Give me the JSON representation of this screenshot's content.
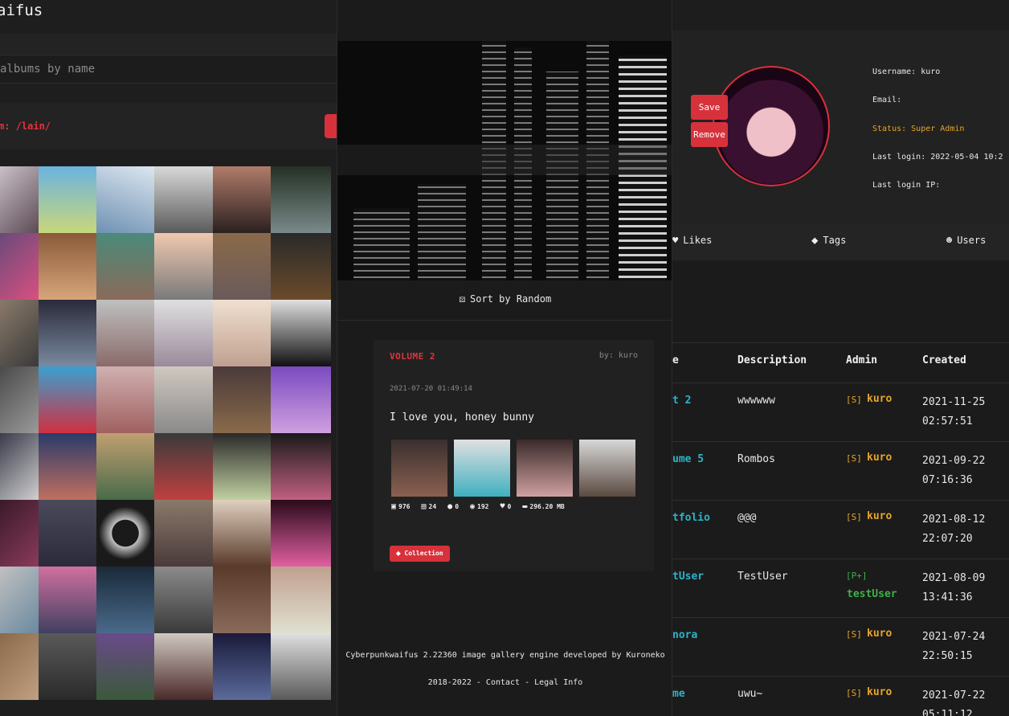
{
  "left": {
    "title": "aifus",
    "search_placeholder": "albums by name",
    "album_path": "m: /lain/"
  },
  "middle": {
    "sort_label": "Sort by Random",
    "card": {
      "volume": "VOLUME 2",
      "by": "by: kuro",
      "date": "2021-07-20 01:49:14",
      "description": "I love you, honey bunny",
      "stats": {
        "images": "976",
        "videos": "24",
        "comments": "0",
        "views": "192",
        "likes": "0",
        "size": "296.20 MB"
      },
      "tag": "Collection"
    },
    "footer_line1": "Cyberpunkwaifus 2.22360 image gallery engine developed by Kuroneko",
    "footer_line2": "2018-2022 - Contact - Legal Info"
  },
  "right": {
    "buttons": {
      "save": "Save",
      "remove": "Remove"
    },
    "info": {
      "username": "Username: kuro",
      "email": "Email:",
      "status": "Status: Super Admin",
      "last_login": "Last login: 2022-05-04 10:2",
      "last_login_ip": "Last login IP:"
    },
    "nav": {
      "likes": "Likes",
      "tags": "Tags",
      "users": "Users"
    },
    "table": {
      "headers": {
        "name": "e",
        "description": "Description",
        "admin": "Admin",
        "created": "Created"
      },
      "rows": [
        {
          "name": "t 2",
          "desc": "wwwwww",
          "role": "[S]",
          "admin": "kuro",
          "created1": "2021-11-25",
          "created2": "02:57:51"
        },
        {
          "name": "ume 5",
          "desc": "Rombos",
          "role": "[S]",
          "admin": "kuro",
          "created1": "2021-09-22",
          "created2": "07:16:36"
        },
        {
          "name": "tfolio",
          "desc": "@@@",
          "role": "[S]",
          "admin": "kuro",
          "created1": "2021-08-12",
          "created2": "22:07:20"
        },
        {
          "name": "tUser",
          "desc": "TestUser",
          "role": "[P+]",
          "admin": "testUser",
          "created1": "2021-08-09",
          "created2": "13:41:36"
        },
        {
          "name": "nora",
          "desc": "",
          "role": "[S]",
          "admin": "kuro",
          "created1": "2021-07-24",
          "created2": "22:50:15"
        },
        {
          "name": "me",
          "desc": "uwu~",
          "role": "[S]",
          "admin": "kuro",
          "created1": "2021-07-22",
          "created2": "05:11:12"
        }
      ]
    }
  },
  "colors": {
    "accent_red": "#d7323c",
    "gold": "#e6a52a",
    "cyan": "#2cb3c9",
    "green": "#3fb04b"
  }
}
